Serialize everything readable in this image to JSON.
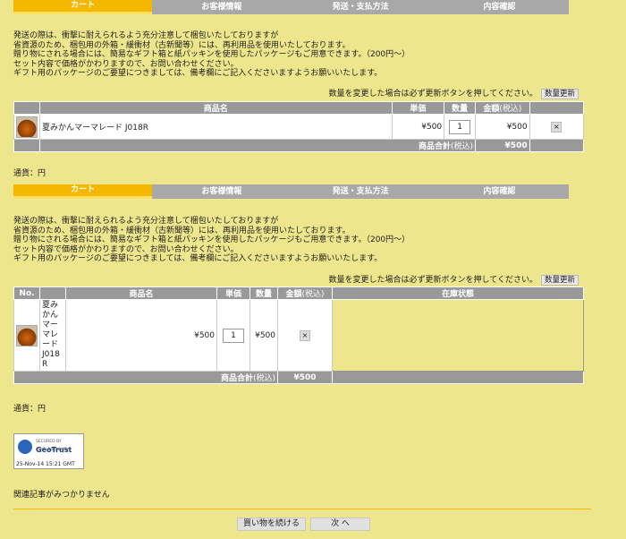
{
  "steps": [
    "カート",
    "お客様情報",
    "発送・支払方法",
    "内容確認"
  ],
  "notice": [
    "発送の際は、衝撃に耐えられるよう充分注意して梱包いたしておりますが",
    "省資源のため、梱包用の外箱・緩衝材（古新聞等）には、再利用品を使用いたしております。",
    "贈り物にされる場合には、簡易なギフト箱と紙パッキンを使用したパッケージもご用意できます。（200円〜）",
    "セット内容で価格がかわりますので、お問い合わせください。",
    "ギフト用のパッケージのご要望につきましては、備考欄にご記入くださいますようお願いいたします。"
  ],
  "update_note": "数量を変更した場合は必ず更新ボタンを押してください。",
  "update_button": "数量更新",
  "cart1": {
    "headers": {
      "name": "商品名",
      "price": "単価",
      "qty": "数量",
      "amount": "金額",
      "amount_tax": "(税込)"
    },
    "item": {
      "name": "夏みかんマーマレード J018R",
      "price": "¥500",
      "qty": "1",
      "amount": "¥500",
      "delete": "×"
    },
    "total_label": "商品合計",
    "total_tax": "(税込)",
    "total_value": "¥500"
  },
  "cart2": {
    "headers": {
      "no": "No.",
      "name": "商品名",
      "price": "単価",
      "qty": "数量",
      "amount": "金額",
      "amount_tax": "(税込)",
      "stock": "在庫状態"
    },
    "item": {
      "name": "夏みかんマーマレードJ018R",
      "name_lines": [
        "夏み",
        "かん",
        "マー",
        "マレ",
        "ード",
        "J018",
        "R"
      ],
      "price": "¥500",
      "qty": "1",
      "amount": "¥500",
      "delete": "×"
    },
    "total_label": "商品合計",
    "total_tax": "(税込)",
    "total_value": "¥500"
  },
  "currency": "通貨：円",
  "seal": {
    "secured": "SECURED BY",
    "brand": "GeoTrust",
    "sub": "click to verify",
    "date": "25-Nov-14 15:21 GMT"
  },
  "related": "関連記事がみつかりません",
  "continue_button": "買い物を続ける",
  "next_button": "次 へ"
}
